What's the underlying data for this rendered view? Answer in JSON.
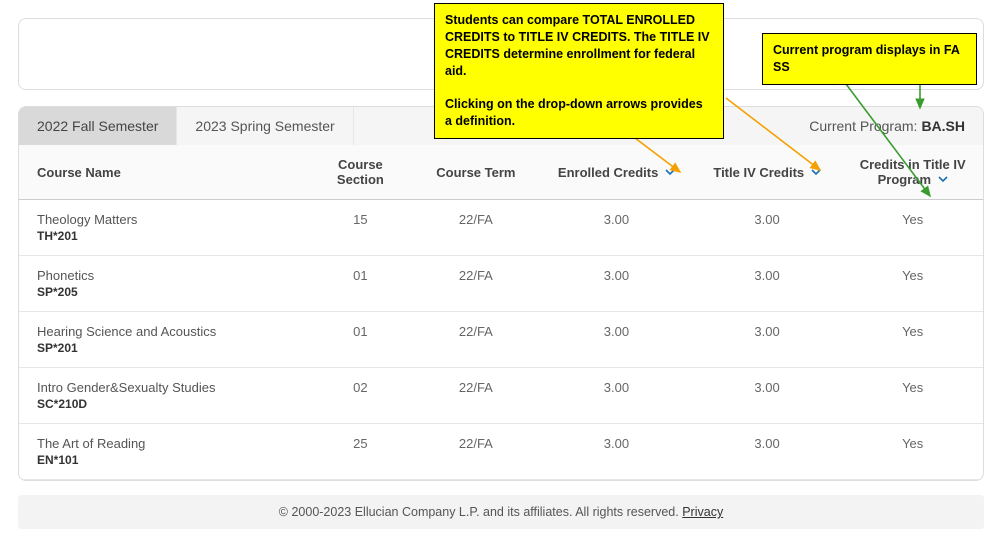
{
  "callouts": {
    "c1_p1": "Students can compare TOTAL ENROLLED CREDITS to TITLE IV CREDITS. The TITLE IV CREDITS determine enrollment for federal aid.",
    "c1_p2": "Clicking on the drop-down arrows provides a definition.",
    "c2": "Current program displays in FA SS"
  },
  "tabs": {
    "active": "2022 Fall Semester",
    "other": "2023 Spring Semester"
  },
  "currentProgram": {
    "label": "Current Program:",
    "value": "BA.SH"
  },
  "headers": {
    "courseName": "Course Name",
    "courseSection": "Course Section",
    "courseTerm": "Course Term",
    "enrolledCredits": "Enrolled Credits",
    "titleIVCredits": "Title IV Credits",
    "creditsInProgram": "Credits in Title IV Program"
  },
  "rows": [
    {
      "name": "Theology Matters",
      "code": "TH*201",
      "section": "15",
      "term": "22/FA",
      "enrolled": "3.00",
      "t4": "3.00",
      "inProg": "Yes"
    },
    {
      "name": "Phonetics",
      "code": "SP*205",
      "section": "01",
      "term": "22/FA",
      "enrolled": "3.00",
      "t4": "3.00",
      "inProg": "Yes"
    },
    {
      "name": "Hearing Science and Acoustics",
      "code": "SP*201",
      "section": "01",
      "term": "22/FA",
      "enrolled": "3.00",
      "t4": "3.00",
      "inProg": "Yes"
    },
    {
      "name": "Intro Gender&Sexualty Studies",
      "code": "SC*210D",
      "section": "02",
      "term": "22/FA",
      "enrolled": "3.00",
      "t4": "3.00",
      "inProg": "Yes"
    },
    {
      "name": "The Art of Reading",
      "code": "EN*101",
      "section": "25",
      "term": "22/FA",
      "enrolled": "3.00",
      "t4": "3.00",
      "inProg": "Yes"
    }
  ],
  "footer": {
    "copyright": "© 2000-2023 Ellucian Company L.P. and its affiliates. All rights reserved.",
    "privacy": "Privacy"
  }
}
